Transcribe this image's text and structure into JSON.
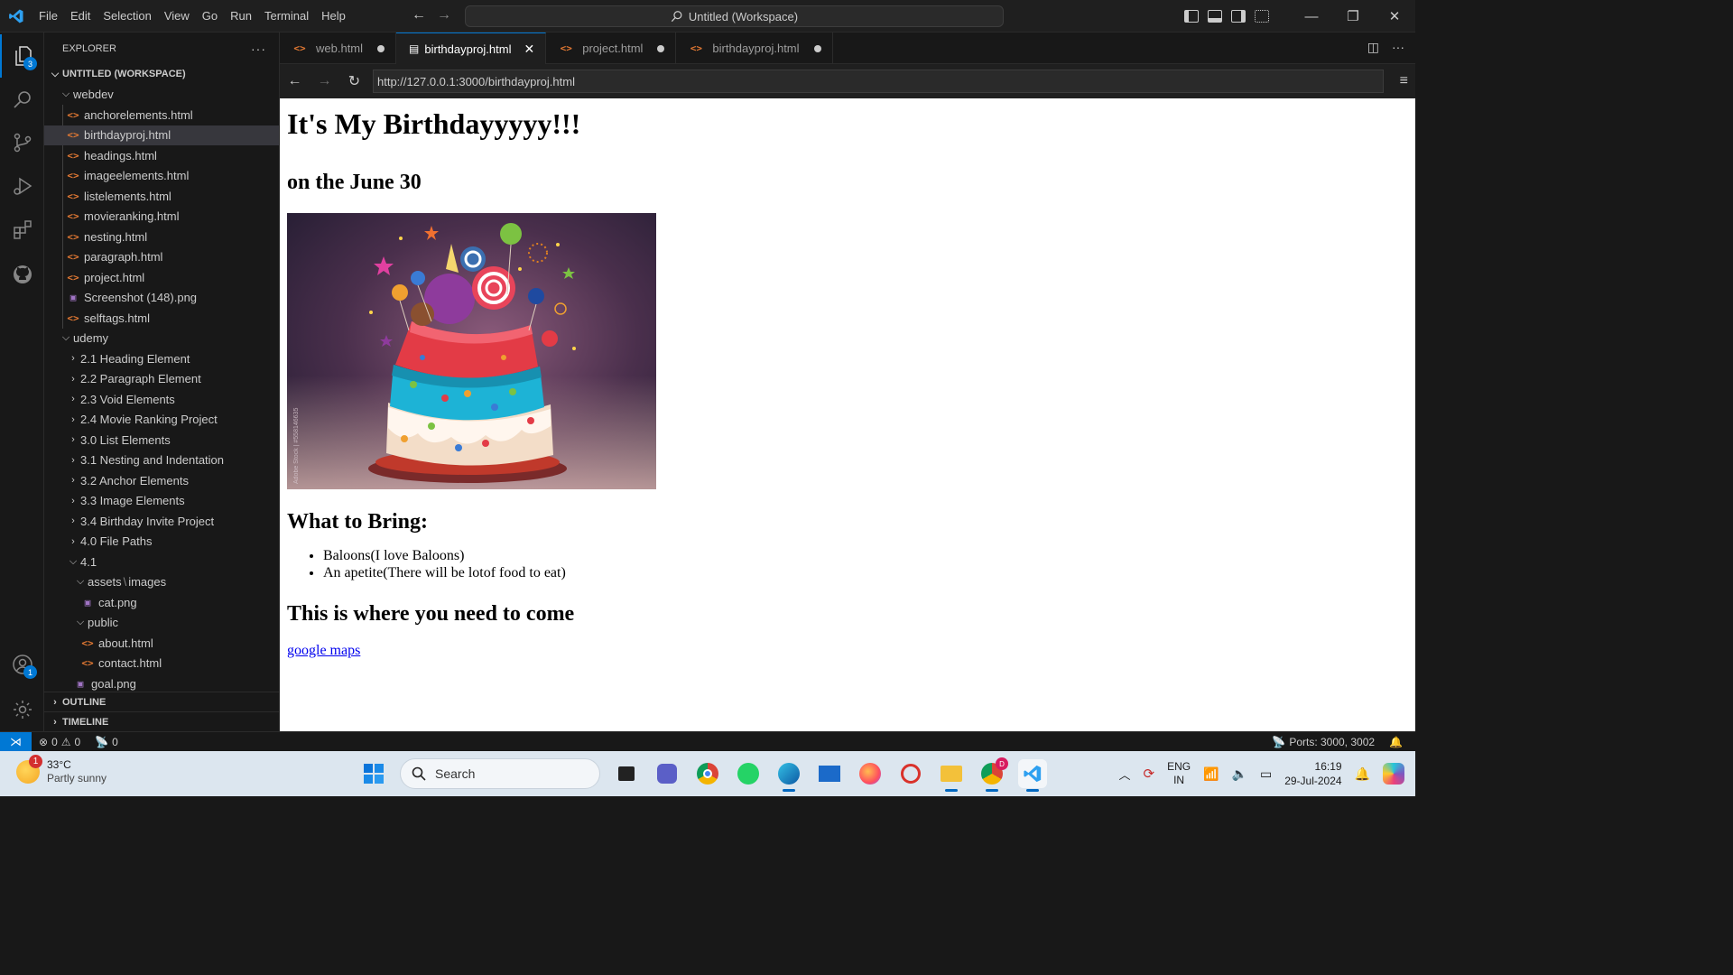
{
  "titlebar": {
    "menu": [
      "File",
      "Edit",
      "Selection",
      "View",
      "Go",
      "Run",
      "Terminal",
      "Help"
    ],
    "search_text": "Untitled (Workspace)",
    "icons": [
      "vscode-logo-icon",
      "arrow-left-icon",
      "arrow-right-icon",
      "search-icon",
      "toggle-primary-sidebar-icon",
      "toggle-panel-icon",
      "toggle-secondary-sidebar-icon",
      "customize-layout-icon",
      "minimize-icon",
      "restore-icon",
      "close-icon"
    ]
  },
  "activitybar": {
    "explorer_badge": "3",
    "accounts_badge": "1",
    "icons": [
      "explorer-icon",
      "search-icon",
      "source-control-icon",
      "run-debug-icon",
      "extensions-icon",
      "github-icon",
      "accounts-icon",
      "settings-gear-icon"
    ]
  },
  "sidebar": {
    "title": "EXPLORER",
    "more": "···",
    "workspace": "UNTITLED (WORKSPACE)",
    "webdev": {
      "label": "webdev",
      "files": [
        {
          "name": "anchorelements.html",
          "type": "html"
        },
        {
          "name": "birthdayproj.html",
          "type": "html"
        },
        {
          "name": "headings.html",
          "type": "html"
        },
        {
          "name": "imageelements.html",
          "type": "html"
        },
        {
          "name": "listelements.html",
          "type": "html"
        },
        {
          "name": "movieranking.html",
          "type": "html"
        },
        {
          "name": "nesting.html",
          "type": "html"
        },
        {
          "name": "paragraph.html",
          "type": "html"
        },
        {
          "name": "project.html",
          "type": "html"
        },
        {
          "name": "Screenshot (148).png",
          "type": "png"
        },
        {
          "name": "selftags.html",
          "type": "html"
        }
      ]
    },
    "udemy": {
      "label": "udemy",
      "folders": [
        "2.1 Heading Element",
        "2.2 Paragraph Element",
        "2.3 Void Elements",
        "2.4 Movie Ranking Project",
        "3.0 List Elements",
        "3.1 Nesting and Indentation",
        "3.2 Anchor Elements",
        "3.3 Image Elements",
        "3.4 Birthday Invite Project",
        "4.0 File Paths"
      ],
      "open_folder": "4.1",
      "assets_folder": "assets",
      "images_folder": "images",
      "cat": "cat.png",
      "public_folder": "public",
      "about": "about.html",
      "contact": "contact.html",
      "goal": "goal.png"
    },
    "outline": "OUTLINE",
    "timeline": "TIMELINE"
  },
  "tabs": [
    {
      "label": "web.html",
      "state": "dirty"
    },
    {
      "label": "birthdayproj.html",
      "state": "active"
    },
    {
      "label": "project.html",
      "state": "dirty"
    },
    {
      "label": "birthdayproj.html",
      "state": "dirty"
    }
  ],
  "browser": {
    "url": "http://127.0.0.1:3000/birthdayproj.html"
  },
  "page": {
    "h1": "It's My Birthdayyyyy!!!",
    "date": "on the June 30",
    "image_watermark": "Adobe Stock | #558146635",
    "bring_heading": "What to Bring:",
    "bring_items": [
      "Baloons(I love Baloons)",
      "An apetite(There will be lotof food to eat)"
    ],
    "where_heading": "This is where you need to come",
    "link": "google maps"
  },
  "statusbar": {
    "errors": "0",
    "warnings": "0",
    "ports_count": "0",
    "ports": "Ports: 3000, 3002"
  },
  "taskbar": {
    "weather_badge": "1",
    "temp": "33°C",
    "condition": "Partly sunny",
    "search": "Search",
    "chrome_badge": "D",
    "lang1": "ENG",
    "lang2": "IN",
    "time": "16:19",
    "date": "29-Jul-2024"
  }
}
